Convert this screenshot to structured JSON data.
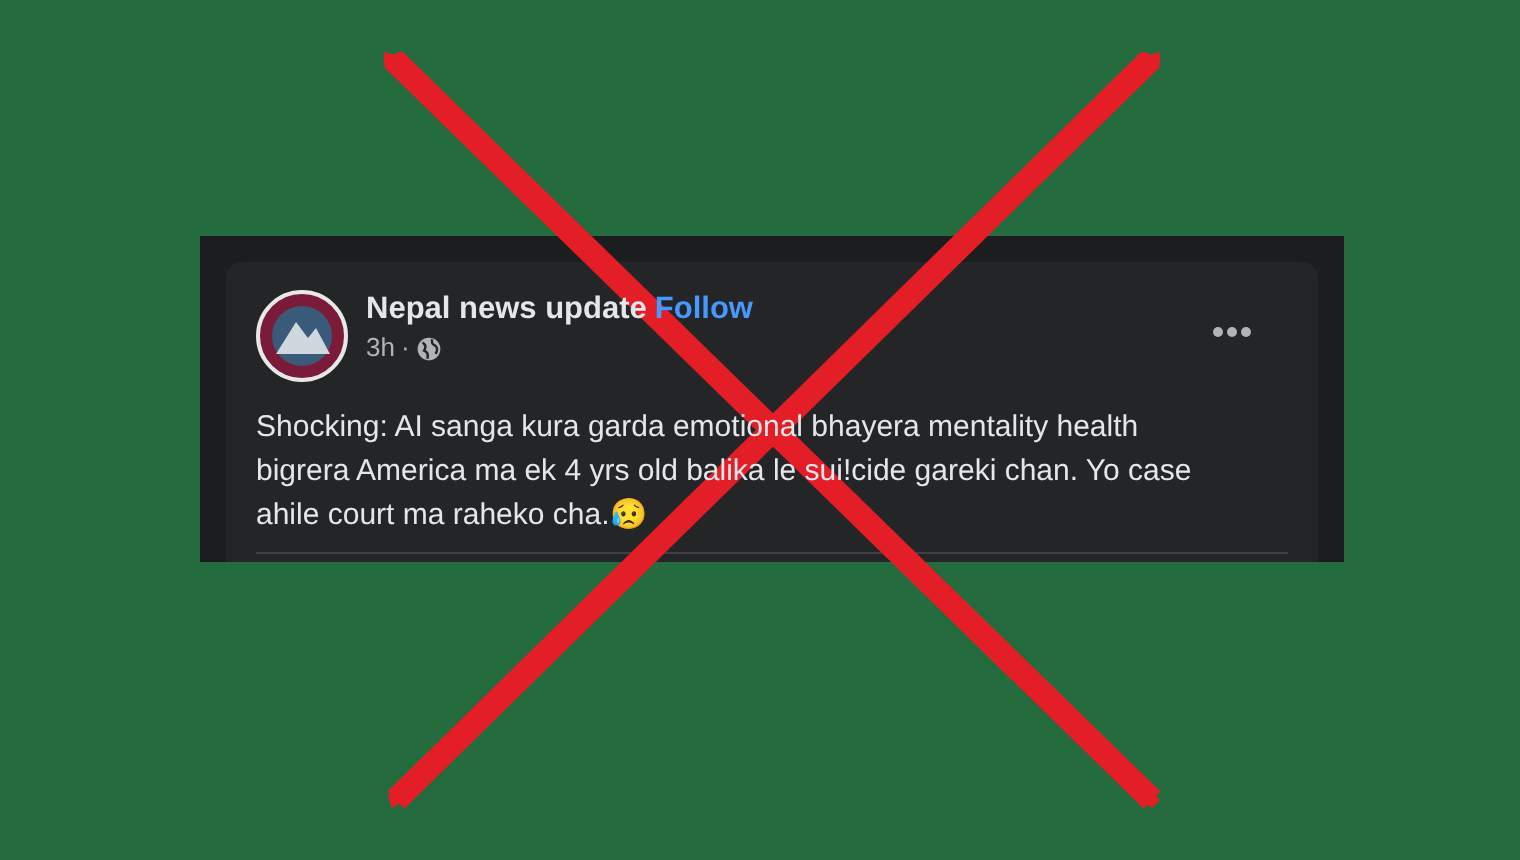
{
  "post": {
    "page_name": "Nepal news update",
    "follow": "Follow",
    "time": "3h",
    "separator": "·",
    "text_lines": [
      "Shocking: AI sanga kura garda emotional bhayera mentality health",
      "bigrera America ma ek 4 yrs old balika le sui!cide gareki chan. Yo case",
      "ahile court ma raheko cha.😥"
    ]
  }
}
